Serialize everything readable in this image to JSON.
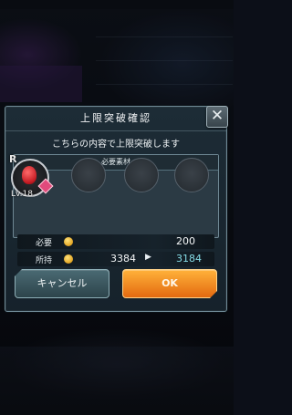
{
  "dialog": {
    "title": "上限突破確認",
    "subtitle": "こちらの内容で上限突破します",
    "materials_header": "必要素材",
    "material": {
      "rarity": "R",
      "level": "Lv.18"
    },
    "required_label": "必要",
    "required_value": "200",
    "owned_label": "所持",
    "owned_before": "3384",
    "arrow": "▶",
    "owned_after": "3184",
    "cancel_label": "キャンセル",
    "ok_label": "OK",
    "close_glyph": "✕"
  },
  "icons": [
    "close-icon",
    "coin-icon",
    "gem-icon"
  ],
  "colors": {
    "ok_button": "#f08a1c",
    "after_value": "#86dce6"
  }
}
